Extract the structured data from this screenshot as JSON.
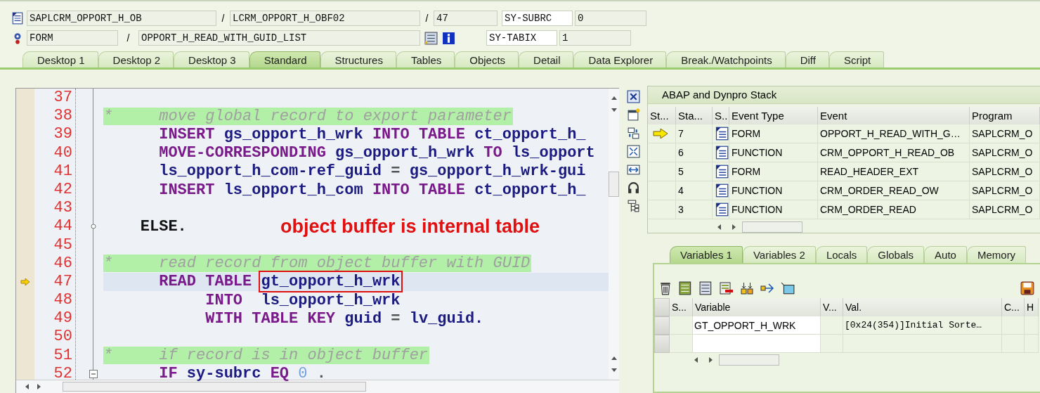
{
  "header": {
    "program": "SAPLCRM_OPPORT_H_OB",
    "include": "LCRM_OPPORT_H_OBF02",
    "line": "47",
    "event_type": "FORM",
    "event": "OPPORT_H_READ_WITH_GUID_LIST",
    "separators": [
      "/",
      "/",
      "/"
    ],
    "sysvars": [
      {
        "name": "SY-SUBRC",
        "value": "0"
      },
      {
        "name": "SY-TABIX",
        "value": "1"
      }
    ]
  },
  "tabs": [
    {
      "label": "Desktop 1",
      "selected": false
    },
    {
      "label": "Desktop 2",
      "selected": false
    },
    {
      "label": "Desktop 3",
      "selected": false
    },
    {
      "label": "Standard",
      "selected": true
    },
    {
      "label": "Structures",
      "selected": false
    },
    {
      "label": "Tables",
      "selected": false
    },
    {
      "label": "Objects",
      "selected": false
    },
    {
      "label": "Detail",
      "selected": false
    },
    {
      "label": "Data Explorer",
      "selected": false
    },
    {
      "label": "Break./Watchpoints",
      "selected": false
    },
    {
      "label": "Diff",
      "selected": false
    },
    {
      "label": "Script",
      "selected": false
    }
  ],
  "code": {
    "lines": [
      {
        "number": "37",
        "kind": "blank",
        "current": false
      },
      {
        "number": "38",
        "kind": "comment",
        "current": false,
        "tokens": [
          {
            "kind": "comment",
            "text": "*     move global record to export parameter"
          }
        ]
      },
      {
        "number": "39",
        "kind": "code",
        "current": false,
        "tokens": [
          {
            "kind": "kw",
            "text": "      INSERT"
          },
          {
            "kind": "id",
            "text": "gs_opport_h_wrk"
          },
          {
            "kind": "kw",
            "text": "INTO"
          },
          {
            "kind": "kw",
            "text": "TABLE"
          },
          {
            "kind": "id",
            "text": "ct_opport_h_"
          }
        ]
      },
      {
        "number": "40",
        "kind": "code",
        "current": false,
        "tokens": [
          {
            "kind": "kw",
            "text": "      MOVE-CORRESPONDING"
          },
          {
            "kind": "id",
            "text": "gs_opport_h_wrk"
          },
          {
            "kind": "kw",
            "text": "TO"
          },
          {
            "kind": "id",
            "text": "ls_opport"
          }
        ]
      },
      {
        "number": "41",
        "kind": "code",
        "current": false,
        "tokens": [
          {
            "kind": "id",
            "text": "      ls_opport_h_com-ref_guid"
          },
          {
            "kind": "op",
            "text": "="
          },
          {
            "kind": "id",
            "text": "gs_opport_h_wrk-gui"
          }
        ]
      },
      {
        "number": "42",
        "kind": "code",
        "current": false,
        "tokens": [
          {
            "kind": "kw",
            "text": "      INSERT"
          },
          {
            "kind": "id",
            "text": "ls_opport_h_com"
          },
          {
            "kind": "kw",
            "text": "INTO"
          },
          {
            "kind": "kw",
            "text": "TABLE"
          },
          {
            "kind": "id",
            "text": "ct_opport_h_"
          }
        ]
      },
      {
        "number": "43",
        "kind": "blank",
        "current": false
      },
      {
        "number": "44",
        "kind": "branch",
        "current": false,
        "tokens": [
          {
            "kind": "ctl",
            "text": "    ELSE."
          },
          {
            "kind": "note",
            "text": "object buffer is internal table"
          }
        ]
      },
      {
        "number": "45",
        "kind": "blank",
        "current": false
      },
      {
        "number": "46",
        "kind": "comment",
        "current": false,
        "tokens": [
          {
            "kind": "comment",
            "text": "*     read record from object buffer with GUID"
          }
        ]
      },
      {
        "number": "47",
        "kind": "code",
        "current": true,
        "tokens": [
          {
            "kind": "kw",
            "text": "      READ"
          },
          {
            "kind": "kw",
            "text": "TABLE"
          },
          {
            "kind": "marked",
            "text": "gt_opport_h_wrk"
          }
        ]
      },
      {
        "number": "48",
        "kind": "code",
        "current": false,
        "tokens": [
          {
            "kind": "kw",
            "text": "           INTO"
          },
          {
            "kind": "id",
            "text": " ls_opport_h_wrk"
          }
        ]
      },
      {
        "number": "49",
        "kind": "code",
        "current": false,
        "tokens": [
          {
            "kind": "kw",
            "text": "           WITH"
          },
          {
            "kind": "kw",
            "text": "TABLE"
          },
          {
            "kind": "kw",
            "text": "KEY"
          },
          {
            "kind": "id",
            "text": "guid"
          },
          {
            "kind": "op",
            "text": "="
          },
          {
            "kind": "id",
            "text": "lv_guid."
          }
        ]
      },
      {
        "number": "50",
        "kind": "blank",
        "current": false
      },
      {
        "number": "51",
        "kind": "comment",
        "current": false,
        "tokens": [
          {
            "kind": "comment",
            "text": "*     if record is in object buffer"
          }
        ]
      },
      {
        "number": "52",
        "kind": "block_start",
        "current": false,
        "tokens": [
          {
            "kind": "kw",
            "text": "      IF"
          },
          {
            "kind": "id",
            "text": "sy-subrc"
          },
          {
            "kind": "kw",
            "text": "EQ"
          },
          {
            "kind": "num",
            "text": "0"
          },
          {
            "kind": "op",
            "text": "."
          }
        ]
      }
    ]
  },
  "stack": {
    "title": "ABAP and Dynpro Stack",
    "columns": [
      "St...",
      "Sta...",
      "S..",
      "Event Type",
      "Event",
      "Program"
    ],
    "rows": [
      {
        "current": true,
        "level": "7",
        "event_type": "FORM",
        "event": "OPPORT_H_READ_WITH_G…",
        "program": "SAPLCRM_O"
      },
      {
        "current": false,
        "level": "6",
        "event_type": "FUNCTION",
        "event": "CRM_OPPORT_H_READ_OB",
        "program": "SAPLCRM_O"
      },
      {
        "current": false,
        "level": "5",
        "event_type": "FORM",
        "event": "READ_HEADER_EXT",
        "program": "SAPLCRM_O"
      },
      {
        "current": false,
        "level": "4",
        "event_type": "FUNCTION",
        "event": "CRM_ORDER_READ_OW",
        "program": "SAPLCRM_O"
      },
      {
        "current": false,
        "level": "3",
        "event_type": "FUNCTION",
        "event": "CRM_ORDER_READ",
        "program": "SAPLCRM_O"
      }
    ]
  },
  "variables": {
    "tabs": [
      {
        "label": "Variables 1",
        "selected": true
      },
      {
        "label": "Variables 2",
        "selected": false
      },
      {
        "label": "Locals",
        "selected": false
      },
      {
        "label": "Globals",
        "selected": false
      },
      {
        "label": "Auto",
        "selected": false
      },
      {
        "label": "Memory",
        "selected": false
      }
    ],
    "columns": [
      "S...",
      "Variable",
      "V...",
      "Val.",
      "C...",
      "H"
    ],
    "rows": [
      {
        "variable": "GT_OPPORT_H_WRK",
        "value": "[0x24(354)]Initial Sorte…"
      }
    ]
  }
}
